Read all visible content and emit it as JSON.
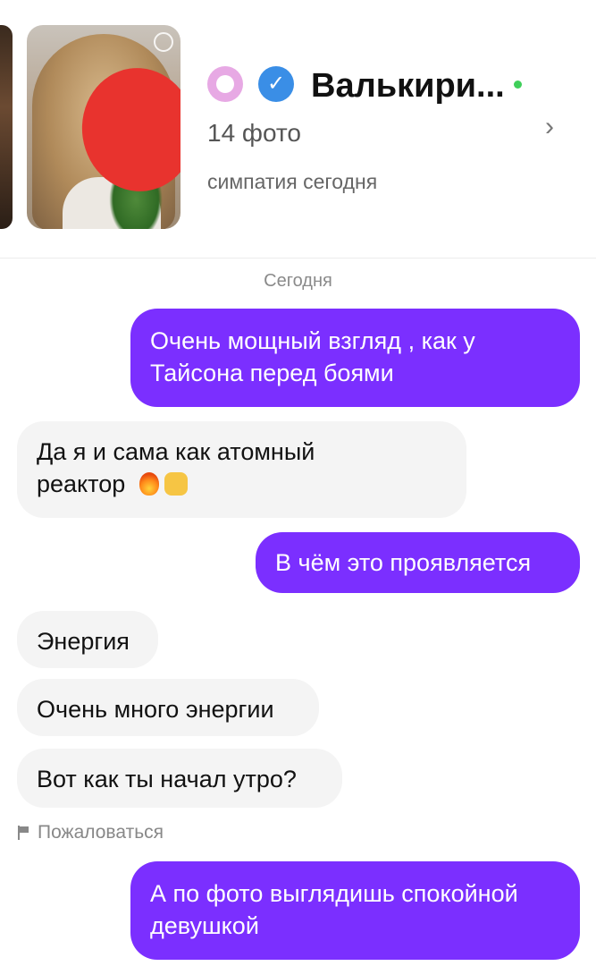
{
  "profile": {
    "name": "Валькири...",
    "photo_count": "14 фото",
    "status": "симпатия сегодня",
    "online_color": "#3fcf5a",
    "icons": [
      "like-badge-icon",
      "verified-icon",
      "chevron-right-icon"
    ]
  },
  "chat": {
    "date_separator": "Сегодня",
    "messages": [
      {
        "side": "out",
        "lines": [
          "Очень мощный взгляд , как у",
          "Тайсона перед боями"
        ]
      },
      {
        "side": "in",
        "lines": [
          "Да я и сама как атомный",
          "реактор"
        ],
        "emoji": [
          "fire-emoji",
          "rock-hand-emoji"
        ]
      },
      {
        "side": "out",
        "lines": [
          "В чём это проявляется"
        ]
      },
      {
        "side": "in",
        "lines": [
          "Энергия"
        ]
      },
      {
        "side": "in",
        "lines": [
          "Очень много энергии"
        ]
      },
      {
        "side": "in",
        "lines": [
          "Вот как ты начал утро?"
        ]
      },
      {
        "side": "out",
        "lines": [
          "А по фото выглядишь спокойной",
          "девушкой"
        ]
      }
    ],
    "report_label": "Пожаловаться"
  },
  "colors": {
    "outgoing_bubble": "#7b2fff",
    "incoming_bubble": "#f4f4f4",
    "verified": "#3a8ee6",
    "redaction": "#e8332e"
  }
}
